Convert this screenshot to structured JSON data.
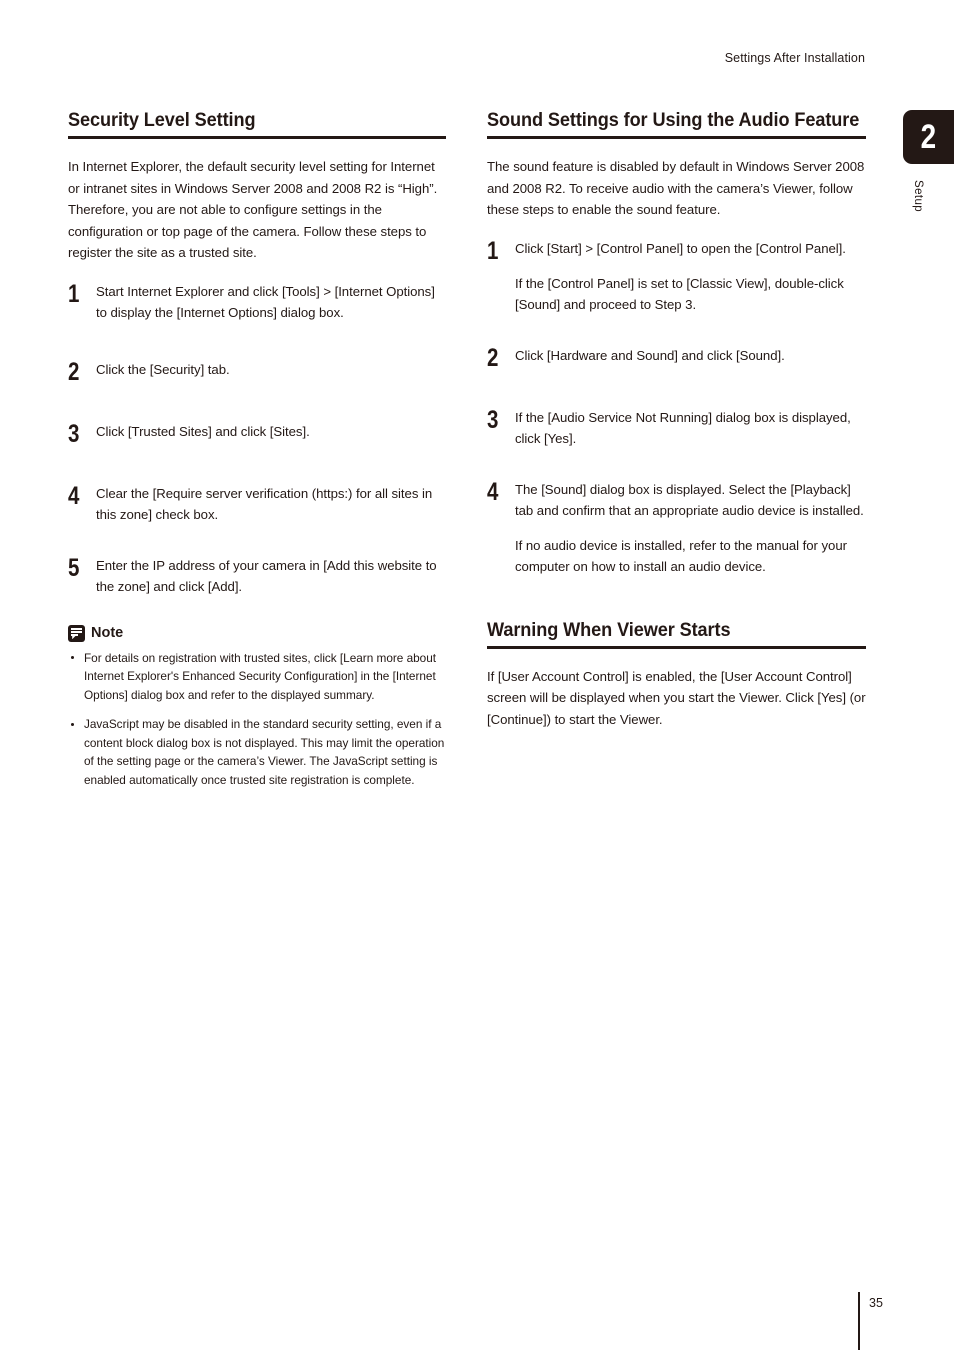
{
  "page": {
    "running_header": "Settings After Installation",
    "folio": "35"
  },
  "chapter_tab": {
    "number": "2",
    "label": "Setup",
    "color": "#231815"
  },
  "left_column": {
    "sections": [
      {
        "heading": "Security Level Setting",
        "intro": "In Internet Explorer, the default security level setting for Internet or intranet sites in Windows Server 2008 and 2008 R2 is “High”. Therefore, you are not able to configure settings in the configuration or top page of the camera. Follow these steps to register the site as a trusted site.",
        "steps": [
          {
            "number": "1",
            "text": "Start Internet Explorer and click [Tools] > [Internet Options] to display the [Internet Options] dialog box."
          },
          {
            "number": "2",
            "text": "Click the [Security] tab."
          },
          {
            "number": "3",
            "text": "Click [Trusted Sites] and click [Sites]."
          },
          {
            "number": "4",
            "text": "Clear the [Require server verification (https:) for all sites in this zone] check box."
          },
          {
            "number": "5",
            "text": "Enter the IP address of your camera in [Add this website to the zone] and click [Add]."
          }
        ],
        "note": {
          "icon": "note-icon",
          "title": "Note",
          "items": [
            "For details on registration with trusted sites, click [Learn more about Internet Explorer's Enhanced Security Configuration] in the [Internet Options] dialog box and refer to the displayed summary.",
            "JavaScript may be disabled in the standard security setting, even if a content block dialog box is not displayed. This may limit the operation of the setting page or the camera’s Viewer. The JavaScript setting is enabled automatically once trusted site registration is complete."
          ]
        }
      }
    ]
  },
  "right_column": {
    "sections": [
      {
        "heading": "Sound Settings for Using the Audio Feature",
        "intro": "The sound feature is disabled by default in Windows Server 2008 and 2008 R2. To receive audio with the camera’s Viewer, follow these steps to enable the sound feature.",
        "steps": [
          {
            "number": "1",
            "text": "Click [Start] > [Control Panel] to open the [Control Panel].",
            "note": "If the [Control Panel] is set to [Classic View], double-click [Sound] and proceed to Step 3."
          },
          {
            "number": "2",
            "text": "Click [Hardware and Sound] and click [Sound]."
          },
          {
            "number": "3",
            "text": "If the [Audio Service Not Running] dialog box is displayed, click [Yes]."
          },
          {
            "number": "4",
            "text": "The [Sound] dialog box is displayed. Select the [Playback] tab and confirm that an appropriate audio device is installed.",
            "note": "If no audio device is installed, refer to the manual for your computer on how to install an audio device."
          }
        ]
      },
      {
        "heading": "Warning When Viewer Starts",
        "intro": "If [User Account Control] is enabled, the [User Account Control] screen will be displayed when you start the Viewer. Click [Yes] (or [Continue]) to start the Viewer."
      }
    ]
  }
}
